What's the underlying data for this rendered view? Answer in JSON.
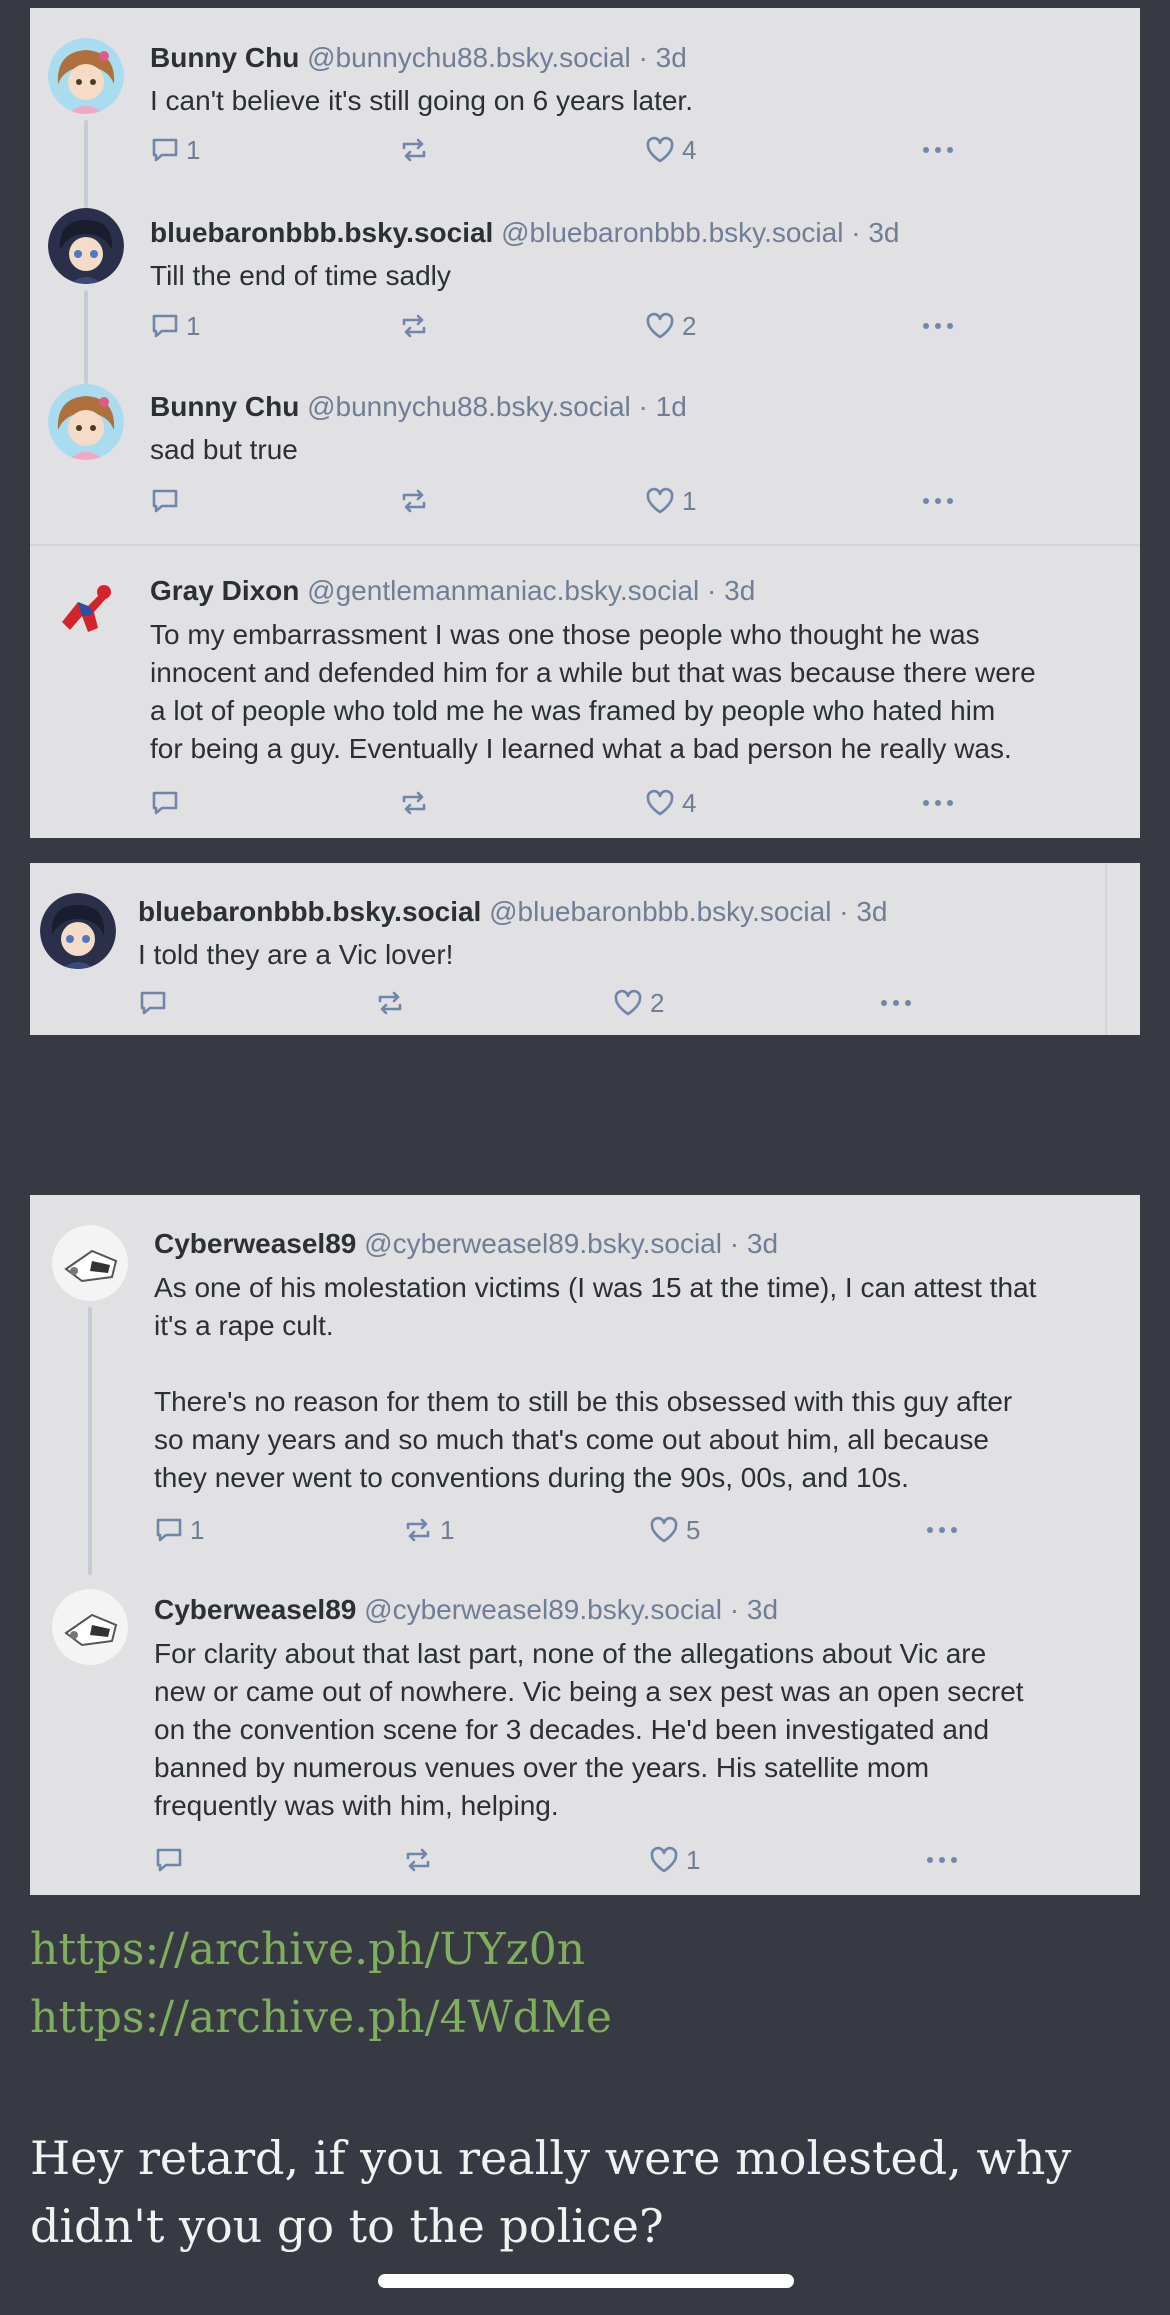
{
  "screenshot1": {
    "posts": [
      {
        "name": "Bunny Chu",
        "handle": "@bunnychu88.bsky.social",
        "sep": "·",
        "age": "3d",
        "text": "I can't believe it's still going on 6 years later.",
        "replies": "1",
        "reposts": "",
        "likes": "4",
        "avatar": "anime-girl-avatar"
      },
      {
        "name": "bluebaronbbb.bsky.social",
        "handle": "@bluebaronbbb.bsky.social",
        "sep": "·",
        "age": "3d",
        "text": "Till the end of time sadly",
        "replies": "1",
        "reposts": "",
        "likes": "2",
        "avatar": "anime-boy-avatar"
      },
      {
        "name": "Bunny Chu",
        "handle": "@bunnychu88.bsky.social",
        "sep": "·",
        "age": "1d",
        "text": "sad but true",
        "replies": "",
        "reposts": "",
        "likes": "1",
        "avatar": "anime-girl-avatar"
      },
      {
        "name": "Gray Dixon",
        "handle": "@gentlemanmaniac.bsky.social",
        "sep": "·",
        "age": "3d",
        "text": "To my embarrassment I was one those people who thought he was\ninnocent and defended him for a while but that was because there were\na lot of people who told me he was framed by people who hated him\nfor being a guy. Eventually I learned what a bad person he really was.",
        "replies": "",
        "reposts": "",
        "likes": "4",
        "avatar": "spiderman-avatar"
      }
    ]
  },
  "screenshot2": {
    "post": {
      "name": "bluebaronbbb.bsky.social",
      "handle": "@bluebaronbbb.bsky.social",
      "sep": "·",
      "age": "3d",
      "text": "I told they are a Vic lover!",
      "replies": "",
      "reposts": "",
      "likes": "2",
      "avatar": "anime-boy-avatar"
    }
  },
  "screenshot3": {
    "posts": [
      {
        "name": "Cyberweasel89",
        "handle": "@cyberweasel89.bsky.social",
        "sep": "·",
        "age": "3d",
        "text": "As one of his molestation victims (I was 15 at the time), I can attest that\nit's a rape cult.\n\nThere's no reason for them to still be this obsessed with this guy after\nso many years and so much that's come out about him, all because\nthey never went to conventions during the 90s, 00s, and 10s.",
        "replies": "1",
        "reposts": "1",
        "likes": "5",
        "avatar": "sketch-avatar"
      },
      {
        "name": "Cyberweasel89",
        "handle": "@cyberweasel89.bsky.social",
        "sep": "·",
        "age": "3d",
        "text": "For clarity about that last part, none of the allegations about Vic are\nnew or came out of nowhere. Vic being a sex pest was an open secret\non the convention scene for 3 decades. He'd been investigated and\nbanned by numerous venues over the years. His satellite mom\nfrequently was with him, helping.",
        "replies": "",
        "reposts": "",
        "likes": "1",
        "avatar": "sketch-avatar"
      }
    ]
  },
  "links": [
    "https://archive.ph/UYz0n",
    "https://archive.ph/4WdMe"
  ],
  "comment": "Hey retard, if you really were molested, why didn't you go to the police?",
  "colors": {
    "background": "#373a42",
    "card": "#e1e1e3",
    "handle": "#6f7e96",
    "link": "#7fae5d"
  }
}
